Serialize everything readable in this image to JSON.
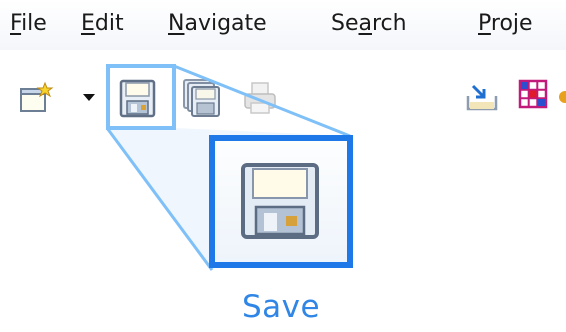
{
  "menubar": {
    "items": [
      {
        "pre": "",
        "mnemonic": "F",
        "post": "ile"
      },
      {
        "pre": "",
        "mnemonic": "E",
        "post": "dit"
      },
      {
        "pre": "",
        "mnemonic": "N",
        "post": "avigate"
      },
      {
        "pre": "Se",
        "mnemonic": "a",
        "post": "rch"
      },
      {
        "pre": "",
        "mnemonic": "P",
        "post": "roje"
      }
    ]
  },
  "toolbar": {
    "icons": [
      "new-icon",
      "dropdown-arrow-icon",
      "save-icon",
      "save-all-icon",
      "print-icon",
      "import-icon",
      "grid-icon"
    ]
  },
  "callout": {
    "label": "Save",
    "accent": "#1f78e8",
    "highlight": "#7ec0f7"
  }
}
